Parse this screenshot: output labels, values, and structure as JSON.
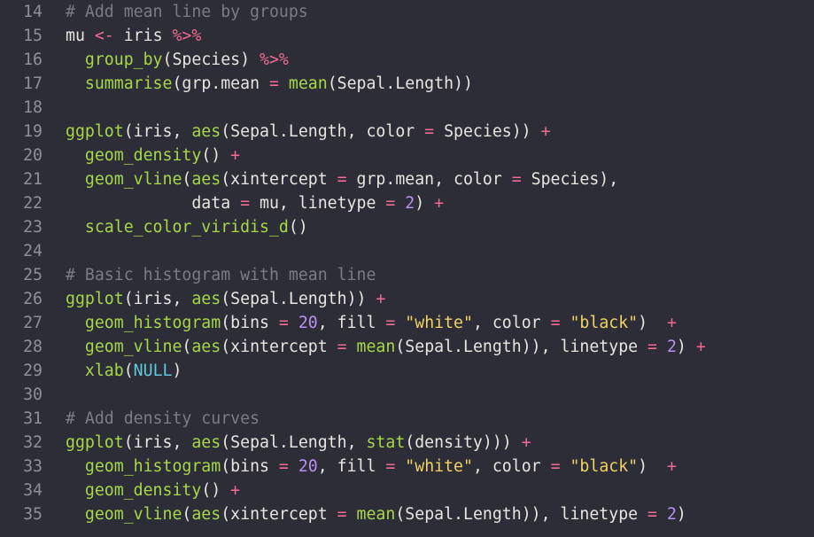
{
  "editor": {
    "lines": [
      {
        "n": "14",
        "tokens": [
          {
            "t": "# Add mean line by groups",
            "k": "comment"
          }
        ]
      },
      {
        "n": "15",
        "tokens": [
          {
            "t": "mu ",
            "k": "plain"
          },
          {
            "t": "<-",
            "k": "op"
          },
          {
            "t": " iris ",
            "k": "plain"
          },
          {
            "t": "%>%",
            "k": "op"
          }
        ]
      },
      {
        "n": "16",
        "tokens": [
          {
            "t": "  ",
            "k": "plain"
          },
          {
            "t": "group_by",
            "k": "fn"
          },
          {
            "t": "(Species) ",
            "k": "plain"
          },
          {
            "t": "%>%",
            "k": "op"
          }
        ]
      },
      {
        "n": "17",
        "tokens": [
          {
            "t": "  ",
            "k": "plain"
          },
          {
            "t": "summarise",
            "k": "fn"
          },
          {
            "t": "(grp.mean ",
            "k": "plain"
          },
          {
            "t": "=",
            "k": "op"
          },
          {
            "t": " ",
            "k": "plain"
          },
          {
            "t": "mean",
            "k": "fn"
          },
          {
            "t": "(Sepal.Length))",
            "k": "plain"
          }
        ]
      },
      {
        "n": "18",
        "tokens": []
      },
      {
        "n": "19",
        "tokens": [
          {
            "t": "ggplot",
            "k": "fn"
          },
          {
            "t": "(iris, ",
            "k": "plain"
          },
          {
            "t": "aes",
            "k": "fn"
          },
          {
            "t": "(Sepal.Length, color ",
            "k": "plain"
          },
          {
            "t": "=",
            "k": "op"
          },
          {
            "t": " Species)) ",
            "k": "plain"
          },
          {
            "t": "+",
            "k": "op"
          }
        ]
      },
      {
        "n": "20",
        "tokens": [
          {
            "t": "  ",
            "k": "plain"
          },
          {
            "t": "geom_density",
            "k": "fn"
          },
          {
            "t": "() ",
            "k": "plain"
          },
          {
            "t": "+",
            "k": "op"
          }
        ]
      },
      {
        "n": "21",
        "tokens": [
          {
            "t": "  ",
            "k": "plain"
          },
          {
            "t": "geom_vline",
            "k": "fn"
          },
          {
            "t": "(",
            "k": "plain"
          },
          {
            "t": "aes",
            "k": "fn"
          },
          {
            "t": "(xintercept ",
            "k": "plain"
          },
          {
            "t": "=",
            "k": "op"
          },
          {
            "t": " grp.mean, color ",
            "k": "plain"
          },
          {
            "t": "=",
            "k": "op"
          },
          {
            "t": " Species),",
            "k": "plain"
          }
        ]
      },
      {
        "n": "22",
        "tokens": [
          {
            "t": "             data ",
            "k": "plain"
          },
          {
            "t": "=",
            "k": "op"
          },
          {
            "t": " mu, linetype ",
            "k": "plain"
          },
          {
            "t": "=",
            "k": "op"
          },
          {
            "t": " ",
            "k": "plain"
          },
          {
            "t": "2",
            "k": "num"
          },
          {
            "t": ") ",
            "k": "plain"
          },
          {
            "t": "+",
            "k": "op"
          }
        ]
      },
      {
        "n": "23",
        "tokens": [
          {
            "t": "  ",
            "k": "plain"
          },
          {
            "t": "scale_color_viridis_d",
            "k": "fn"
          },
          {
            "t": "()",
            "k": "plain"
          }
        ]
      },
      {
        "n": "24",
        "tokens": []
      },
      {
        "n": "25",
        "tokens": [
          {
            "t": "# Basic histogram with mean line",
            "k": "comment"
          }
        ]
      },
      {
        "n": "26",
        "tokens": [
          {
            "t": "ggplot",
            "k": "fn"
          },
          {
            "t": "(iris, ",
            "k": "plain"
          },
          {
            "t": "aes",
            "k": "fn"
          },
          {
            "t": "(Sepal.Length)) ",
            "k": "plain"
          },
          {
            "t": "+",
            "k": "op"
          }
        ]
      },
      {
        "n": "27",
        "tokens": [
          {
            "t": "  ",
            "k": "plain"
          },
          {
            "t": "geom_histogram",
            "k": "fn"
          },
          {
            "t": "(bins ",
            "k": "plain"
          },
          {
            "t": "=",
            "k": "op"
          },
          {
            "t": " ",
            "k": "plain"
          },
          {
            "t": "20",
            "k": "num"
          },
          {
            "t": ", fill ",
            "k": "plain"
          },
          {
            "t": "=",
            "k": "op"
          },
          {
            "t": " ",
            "k": "plain"
          },
          {
            "t": "\"white\"",
            "k": "str"
          },
          {
            "t": ", color ",
            "k": "plain"
          },
          {
            "t": "=",
            "k": "op"
          },
          {
            "t": " ",
            "k": "plain"
          },
          {
            "t": "\"black\"",
            "k": "str"
          },
          {
            "t": ")  ",
            "k": "plain"
          },
          {
            "t": "+",
            "k": "op"
          }
        ]
      },
      {
        "n": "28",
        "tokens": [
          {
            "t": "  ",
            "k": "plain"
          },
          {
            "t": "geom_vline",
            "k": "fn"
          },
          {
            "t": "(",
            "k": "plain"
          },
          {
            "t": "aes",
            "k": "fn"
          },
          {
            "t": "(xintercept ",
            "k": "plain"
          },
          {
            "t": "=",
            "k": "op"
          },
          {
            "t": " ",
            "k": "plain"
          },
          {
            "t": "mean",
            "k": "fn"
          },
          {
            "t": "(Sepal.Length)), linetype ",
            "k": "plain"
          },
          {
            "t": "=",
            "k": "op"
          },
          {
            "t": " ",
            "k": "plain"
          },
          {
            "t": "2",
            "k": "num"
          },
          {
            "t": ") ",
            "k": "plain"
          },
          {
            "t": "+",
            "k": "op"
          }
        ]
      },
      {
        "n": "29",
        "tokens": [
          {
            "t": "  ",
            "k": "plain"
          },
          {
            "t": "xlab",
            "k": "fn"
          },
          {
            "t": "(",
            "k": "plain"
          },
          {
            "t": "NULL",
            "k": "const"
          },
          {
            "t": ")",
            "k": "plain"
          }
        ]
      },
      {
        "n": "30",
        "tokens": []
      },
      {
        "n": "31",
        "tokens": [
          {
            "t": "# Add density curves",
            "k": "comment"
          }
        ]
      },
      {
        "n": "32",
        "tokens": [
          {
            "t": "ggplot",
            "k": "fn"
          },
          {
            "t": "(iris, ",
            "k": "plain"
          },
          {
            "t": "aes",
            "k": "fn"
          },
          {
            "t": "(Sepal.Length, ",
            "k": "plain"
          },
          {
            "t": "stat",
            "k": "fn"
          },
          {
            "t": "(density))) ",
            "k": "plain"
          },
          {
            "t": "+",
            "k": "op"
          }
        ]
      },
      {
        "n": "33",
        "tokens": [
          {
            "t": "  ",
            "k": "plain"
          },
          {
            "t": "geom_histogram",
            "k": "fn"
          },
          {
            "t": "(bins ",
            "k": "plain"
          },
          {
            "t": "=",
            "k": "op"
          },
          {
            "t": " ",
            "k": "plain"
          },
          {
            "t": "20",
            "k": "num"
          },
          {
            "t": ", fill ",
            "k": "plain"
          },
          {
            "t": "=",
            "k": "op"
          },
          {
            "t": " ",
            "k": "plain"
          },
          {
            "t": "\"white\"",
            "k": "str"
          },
          {
            "t": ", color ",
            "k": "plain"
          },
          {
            "t": "=",
            "k": "op"
          },
          {
            "t": " ",
            "k": "plain"
          },
          {
            "t": "\"black\"",
            "k": "str"
          },
          {
            "t": ")  ",
            "k": "plain"
          },
          {
            "t": "+",
            "k": "op"
          }
        ]
      },
      {
        "n": "34",
        "tokens": [
          {
            "t": "  ",
            "k": "plain"
          },
          {
            "t": "geom_density",
            "k": "fn"
          },
          {
            "t": "() ",
            "k": "plain"
          },
          {
            "t": "+",
            "k": "op"
          }
        ]
      },
      {
        "n": "35",
        "tokens": [
          {
            "t": "  ",
            "k": "plain"
          },
          {
            "t": "geom_vline",
            "k": "fn"
          },
          {
            "t": "(",
            "k": "plain"
          },
          {
            "t": "aes",
            "k": "fn"
          },
          {
            "t": "(xintercept ",
            "k": "plain"
          },
          {
            "t": "=",
            "k": "op"
          },
          {
            "t": " ",
            "k": "plain"
          },
          {
            "t": "mean",
            "k": "fn"
          },
          {
            "t": "(Sepal.Length)), linetype ",
            "k": "plain"
          },
          {
            "t": "=",
            "k": "op"
          },
          {
            "t": " ",
            "k": "plain"
          },
          {
            "t": "2",
            "k": "num"
          },
          {
            "t": ")",
            "k": "plain"
          }
        ]
      }
    ]
  },
  "colors": {
    "background": "#2c2d37",
    "line_number": "#8d8f99",
    "comment": "#7a7c86",
    "function": "#a6d84a",
    "operator": "#f36b8f",
    "string": "#f1d264",
    "number": "#b891f0",
    "constant": "#62c8dc",
    "text": "#e8e6df"
  }
}
